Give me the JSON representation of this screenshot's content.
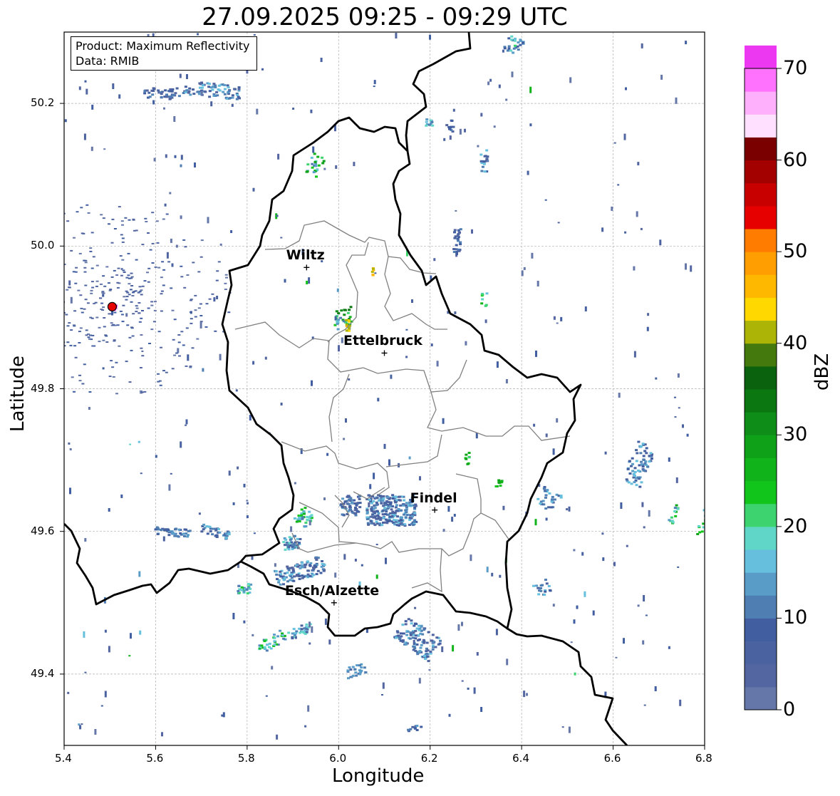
{
  "title": "27.09.2025 09:25 - 09:29 UTC",
  "product_line": "Product: Maximum Reflectivity",
  "data_line": "Data: RMIB",
  "axes": {
    "xlabel": "Longitude",
    "ylabel": "Latitude",
    "xlim": [
      5.4,
      6.8
    ],
    "ylim": [
      49.3,
      50.3
    ],
    "xticks": [
      "5.4",
      "5.6",
      "5.8",
      "6.0",
      "6.2",
      "6.4",
      "6.6",
      "6.8"
    ],
    "yticks": [
      "49.4",
      "49.6",
      "49.8",
      "50.0",
      "50.2"
    ],
    "grid": true
  },
  "places": [
    {
      "name": "Wiltz",
      "lon": 5.93,
      "lat": 49.97
    },
    {
      "name": "Ettelbruck",
      "lon": 6.1,
      "lat": 49.85
    },
    {
      "name": "Findel",
      "lon": 6.21,
      "lat": 49.63
    },
    {
      "name": "Esch/Alzette",
      "lon": 5.99,
      "lat": 49.5
    }
  ],
  "radar_site": {
    "lon": 5.505,
    "lat": 49.915
  },
  "colorbar": {
    "label": "dBZ",
    "ticks": [
      "0",
      "10",
      "20",
      "30",
      "40",
      "50",
      "60",
      "70"
    ],
    "min": 0,
    "max": 70,
    "step": 2.5,
    "colors": [
      "#6577a9",
      "#5366a1",
      "#4a63a0",
      "#415ea1",
      "#4f7eb3",
      "#5a9cc8",
      "#66c0dd",
      "#5fd6c7",
      "#3dd46f",
      "#12c51b",
      "#10b41a",
      "#0fa219",
      "#0e8e18",
      "#0b7711",
      "#0a620e",
      "#447a0d",
      "#acb406",
      "#ffd800",
      "#ffb800",
      "#ff9e00",
      "#ff7c00",
      "#e60000",
      "#c80000",
      "#a30000",
      "#7a0000",
      "#ffe0fe",
      "#ffb0fd",
      "#ff72fd",
      "#ec39f1"
    ]
  }
}
